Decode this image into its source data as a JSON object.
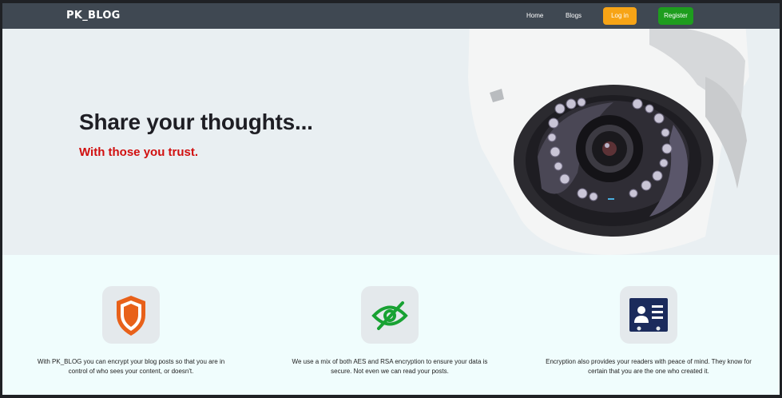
{
  "nav": {
    "brand": "PK_BLOG",
    "links": [
      "Home",
      "Blogs"
    ],
    "login_label": "Log in",
    "register_label": "Register"
  },
  "hero": {
    "title": "Share your thoughts...",
    "subtitle": "With those you trust."
  },
  "features": [
    {
      "icon": "shield-icon",
      "text": "With PK_BLOG you can encrypt your blog posts so that you are in control of who sees your content, or doesn't."
    },
    {
      "icon": "eye-slash-icon",
      "text": "We use a mix of both AES and RSA encryption to ensure your data is secure. Not even we can read your posts."
    },
    {
      "icon": "id-card-icon",
      "text": "Encryption also provides your readers with peace of mind. They know for certain that you are the one who created it."
    }
  ],
  "colors": {
    "navbar": "#3f4852",
    "login": "#f7a416",
    "register": "#1e9d1e",
    "accent_red": "#d10f0f",
    "shield": "#e8611a",
    "eye": "#18a233",
    "idcard": "#1b2b5c"
  }
}
